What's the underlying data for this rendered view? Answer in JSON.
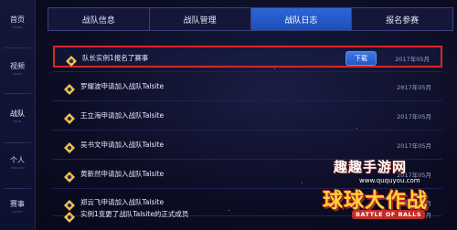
{
  "sidebar": {
    "items": [
      {
        "label": "首页",
        "sub": "HOME"
      },
      {
        "label": "视频",
        "sub": "VIDEO"
      },
      {
        "label": "战队",
        "sub": "TEAM"
      },
      {
        "label": "个人",
        "sub": "PERSON"
      },
      {
        "label": "赛事",
        "sub": "MATCH"
      }
    ],
    "active_index": 2
  },
  "tabs": [
    {
      "label": "战队信息"
    },
    {
      "label": "战队管理"
    },
    {
      "label": "战队日志"
    },
    {
      "label": "报名参赛"
    }
  ],
  "active_tab": 2,
  "log": {
    "rows": [
      {
        "text": "队长实例1报名了赛事",
        "date": "2017年05月",
        "download_label": "下载"
      },
      {
        "text": "罗耀波申请加入战队Talsite",
        "date": "2017年05月"
      },
      {
        "text": "王立海申请加入战队Talsite",
        "date": "2017年05月"
      },
      {
        "text": "吴书文申请加入战队Talsite",
        "date": "2017年05月"
      },
      {
        "text": "黄新然申请加入战队Talsite",
        "date": "2017年05月"
      },
      {
        "text": "郑云飞申请加入战队Talsite",
        "date": "2017年05月"
      },
      {
        "text": "实例1变更了战队Talsite的正式成员",
        "date": "2017年05月"
      }
    ],
    "highlight_color": "#d8272b"
  },
  "watermark": {
    "site_name": "趣趣手游网",
    "url": "www.ququyou.com",
    "logo": "球球大作战",
    "logo_en": "BATTLE OF BALLS"
  }
}
